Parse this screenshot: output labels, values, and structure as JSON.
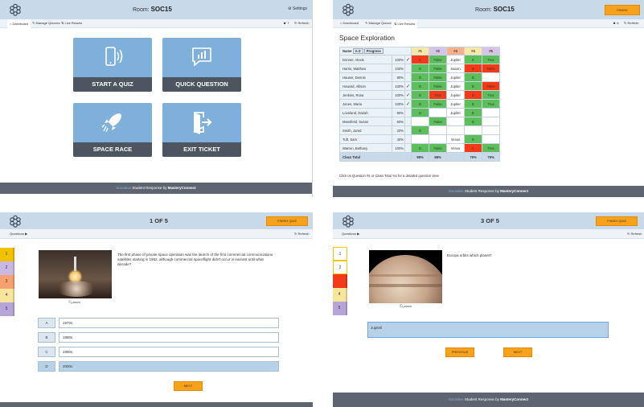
{
  "brand": {
    "socrative": "Socrative",
    "rest": " Student Response by ",
    "mc": "MasteryConnect"
  },
  "colors": {
    "accent": "#f7a21a",
    "topbar": "#c8d9ea",
    "tile": "#7fb0db",
    "correct": "#5cbf5c",
    "wrong": "#f23a19"
  },
  "dashboard": {
    "room_label": "Room:",
    "room": "SOC15",
    "settings": "Settings",
    "tabs": [
      "Dashboard",
      "Manage Quizzes",
      "Live Results"
    ],
    "count": "7",
    "refresh": "Refresh",
    "tiles": [
      {
        "label": "START A QUIZ",
        "icon": "phone-signal-icon"
      },
      {
        "label": "QUICK QUESTION",
        "icon": "chat-chart-icon"
      },
      {
        "label": "SPACE RACE",
        "icon": "rocket-icon"
      },
      {
        "label": "EXIT TICKET",
        "icon": "exit-door-icon"
      }
    ]
  },
  "results": {
    "room_label": "Room:",
    "room": "SOC15",
    "finish": "FINISH",
    "tabs": [
      "Dashboard",
      "Manage Quizzes",
      "Live Results"
    ],
    "count": "6",
    "refresh": "Refresh",
    "title": "Space Exploration",
    "name_label": "Name",
    "sort": "A-Z",
    "view": "Progress",
    "cols": [
      "#1",
      "#2",
      "#3",
      "#4",
      "#5"
    ],
    "col_colors": [
      "#f6e9a8",
      "#d6c4e8",
      "#f6b08a",
      "#f6e9a8",
      "#d6c4e8"
    ],
    "rows": [
      {
        "name": "Donner, Alexis",
        "pct": "100%",
        "check": "✓",
        "cells": [
          [
            "C",
            "r"
          ],
          [
            "False",
            "g"
          ],
          [
            "Jupiter",
            "w"
          ],
          [
            "E",
            "g"
          ],
          [
            "True",
            "g"
          ]
        ]
      },
      {
        "name": "Harris, Matthew",
        "pct": "100%",
        "check": "",
        "cells": [
          [
            "D",
            "g"
          ],
          [
            "False",
            "g"
          ],
          [
            "Saturn",
            "w"
          ],
          [
            "B",
            "r"
          ],
          [
            "False",
            "r"
          ]
        ]
      },
      {
        "name": "Hauser, Dennis",
        "pct": "80%",
        "check": "",
        "cells": [
          [
            "D",
            "g"
          ],
          [
            "False",
            "g"
          ],
          [
            "Jupiter",
            "w"
          ],
          [
            "E",
            "g"
          ],
          [
            "",
            ""
          ]
        ]
      },
      {
        "name": "Howard, Allison",
        "pct": "100%",
        "check": "✓",
        "cells": [
          [
            "D",
            "g"
          ],
          [
            "False",
            "g"
          ],
          [
            "Jupiter",
            "w"
          ],
          [
            "E",
            "g"
          ],
          [
            "False",
            "r"
          ]
        ]
      },
      {
        "name": "Jenkins, Rosa",
        "pct": "100%",
        "check": "✓",
        "cells": [
          [
            "D",
            "g"
          ],
          [
            "True",
            "r"
          ],
          [
            "Jupiter",
            "w"
          ],
          [
            "D",
            "r"
          ],
          [
            "True",
            "g"
          ]
        ]
      },
      {
        "name": "Jones, Maria",
        "pct": "100%",
        "check": "✓",
        "cells": [
          [
            "D",
            "g"
          ],
          [
            "False",
            "g"
          ],
          [
            "Jupiter",
            "w"
          ],
          [
            "E",
            "g"
          ],
          [
            "True",
            "g"
          ]
        ]
      },
      {
        "name": "Loveland, Dariah",
        "pct": "80%",
        "check": "",
        "cells": [
          [
            "D",
            "g"
          ],
          [
            "",
            "w"
          ],
          [
            "Jupiter",
            "w"
          ],
          [
            "E",
            "g"
          ],
          [
            "",
            ""
          ]
        ]
      },
      {
        "name": "Mansfield, Susan",
        "pct": "60%",
        "check": "",
        "cells": [
          [
            "",
            "w"
          ],
          [
            "False",
            "g"
          ],
          [
            "",
            "w"
          ],
          [
            "E",
            "g"
          ],
          [
            "",
            ""
          ]
        ]
      },
      {
        "name": "Smith, Jared",
        "pct": "20%",
        "check": "",
        "cells": [
          [
            "D",
            "g"
          ],
          [
            "",
            "w"
          ],
          [
            "",
            "w"
          ],
          [
            "",
            "w"
          ],
          [
            "",
            ""
          ]
        ]
      },
      {
        "name": "Tuft, Sam",
        "pct": "40%",
        "check": "",
        "cells": [
          [
            "",
            "w"
          ],
          [
            "",
            "w"
          ],
          [
            "Venus",
            "w"
          ],
          [
            "E",
            "g"
          ],
          [
            "",
            ""
          ]
        ]
      },
      {
        "name": "Warren, Bethany",
        "pct": "100%",
        "check": "",
        "cells": [
          [
            "D",
            "g"
          ],
          [
            "False",
            "g"
          ],
          [
            "Venus",
            "w"
          ],
          [
            "C",
            "r"
          ],
          [
            "True",
            "g"
          ]
        ]
      }
    ],
    "total_label": "Class Total",
    "totals": [
      "89%",
      "88%",
      "",
      "70%",
      "75%"
    ],
    "hint": "Click on Question #s or Class Total %s for a detailed question view"
  },
  "quiz1": {
    "progress": "1 OF 5",
    "finish": "FINISH QUIZ",
    "questions": "Questions ▶",
    "refresh": "Refresh",
    "nums": [
      "1",
      "2",
      "3",
      "4",
      "5"
    ],
    "num_colors": [
      "#f2c200",
      "#c9b8e2",
      "#f5a06e",
      "#f6e59a",
      "#b6a5d8"
    ],
    "question": "The first phase of private space operation was the launch of the first commercial communications satellites starting in 1962, although commercial spaceflight didn't occur in earnest until what decade?",
    "zoom": "zoom",
    "answers": [
      {
        "letter": "A",
        "text": "1970s"
      },
      {
        "letter": "B",
        "text": "1980s"
      },
      {
        "letter": "C",
        "text": "1990s"
      },
      {
        "letter": "D",
        "text": "2000s"
      }
    ],
    "selected": "D",
    "next": "NEXT"
  },
  "quiz3": {
    "progress": "3 OF 5",
    "finish": "FINISH QUIZ",
    "questions": "Questions ▶",
    "refresh": "Refresh",
    "nums": [
      "1",
      "2",
      "",
      "4",
      "5"
    ],
    "num_colors": [
      "#ffffff",
      "#ffffff",
      "#f23a19",
      "#f6e59a",
      "#b6a5d8"
    ],
    "question": "Europa orbits which planet?",
    "zoom": "zoom",
    "answer": "Jupitell",
    "prev": "PREVIOUS",
    "next": "NEXT"
  }
}
